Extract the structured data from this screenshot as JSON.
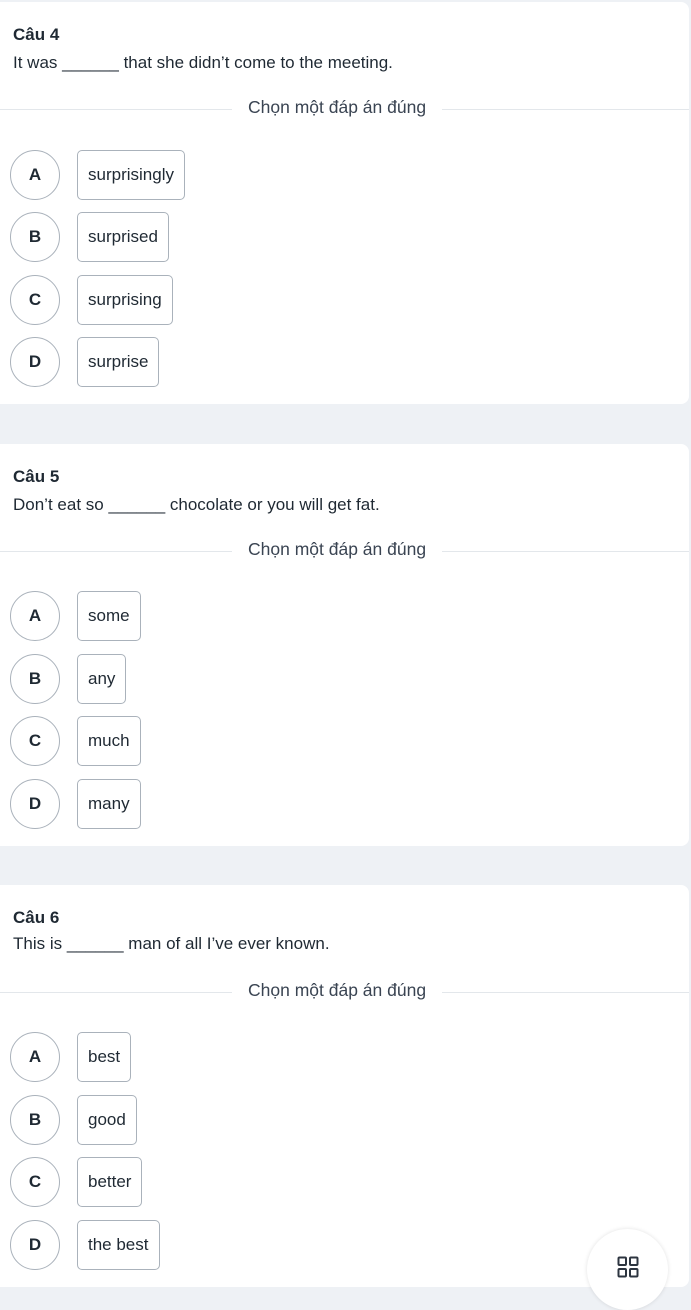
{
  "divider_label": "Chọn một đáp án đúng",
  "questions": [
    {
      "title": "Câu 4",
      "text": "It was ______ that she didn’t come to the meeting.",
      "options": [
        {
          "letter": "A",
          "text": "surprisingly"
        },
        {
          "letter": "B",
          "text": "surprised"
        },
        {
          "letter": "C",
          "text": "surprising"
        },
        {
          "letter": "D",
          "text": "surprise"
        }
      ]
    },
    {
      "title": "Câu 5",
      "text": "Don’t eat so ______ chocolate or you will get fat.",
      "options": [
        {
          "letter": "A",
          "text": "some"
        },
        {
          "letter": "B",
          "text": "any"
        },
        {
          "letter": "C",
          "text": "much"
        },
        {
          "letter": "D",
          "text": "many"
        }
      ]
    },
    {
      "title": "Câu 6",
      "text": "This is ______ man of all I’ve ever known.",
      "options": [
        {
          "letter": "A",
          "text": "best"
        },
        {
          "letter": "B",
          "text": "good"
        },
        {
          "letter": "C",
          "text": "better"
        },
        {
          "letter": "D",
          "text": "the best"
        }
      ]
    }
  ],
  "fab": {
    "icon": "grid-icon"
  }
}
